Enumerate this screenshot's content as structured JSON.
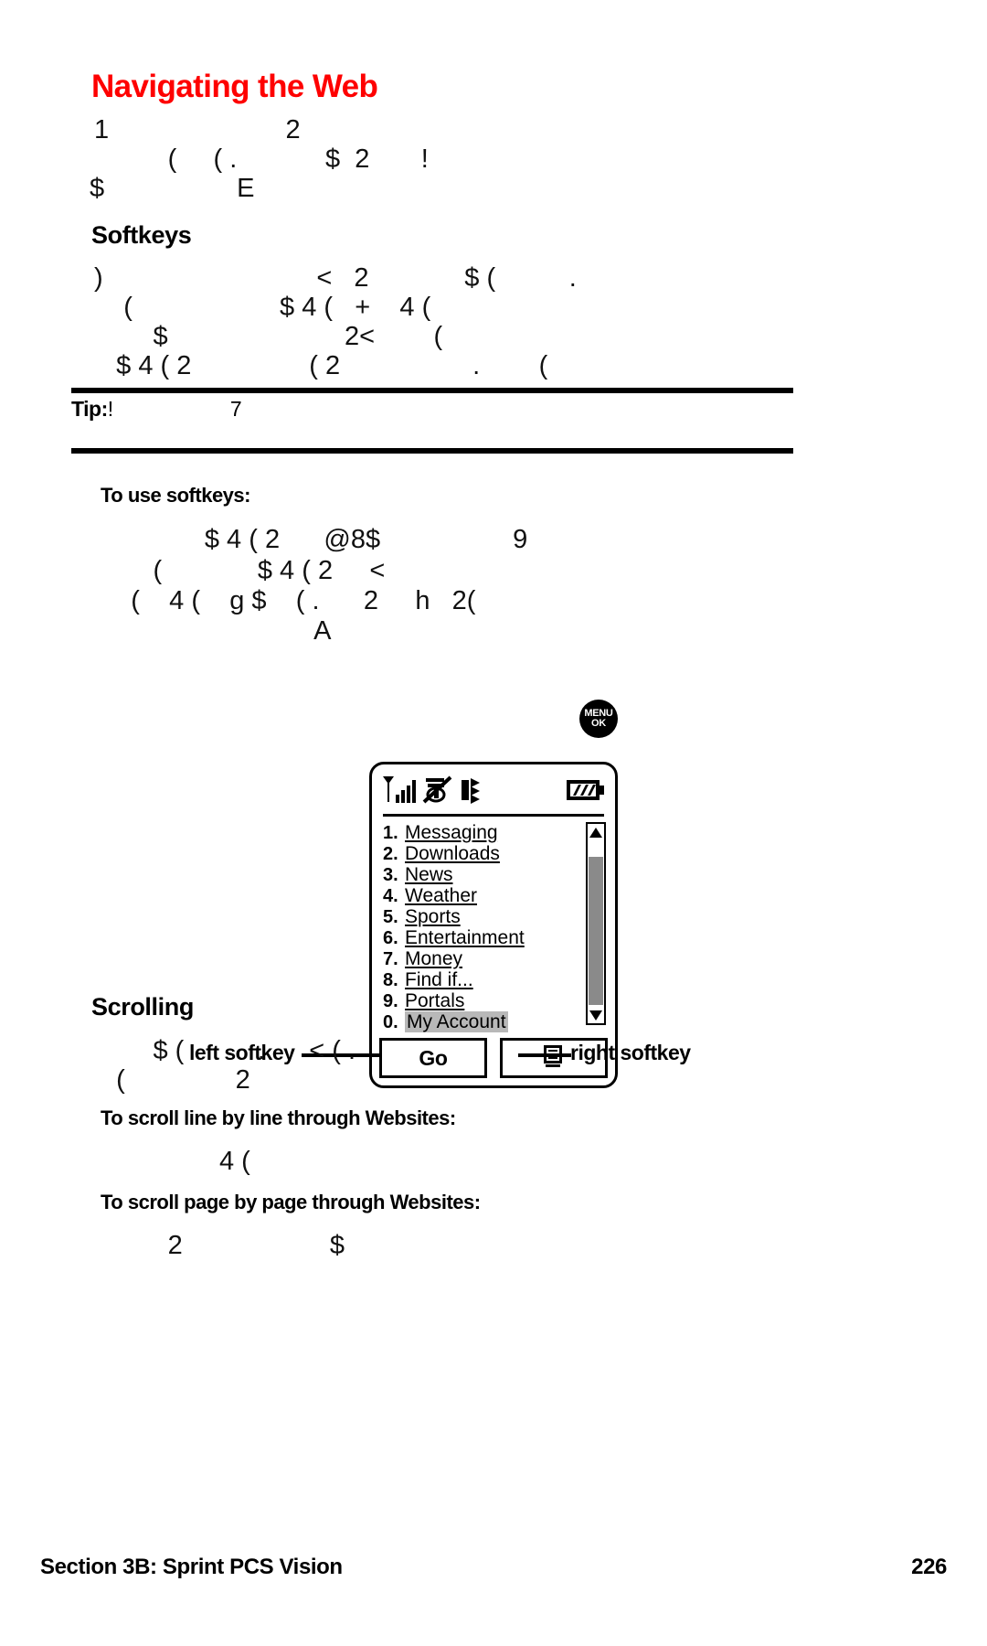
{
  "document": {
    "title": "Navigating the Web",
    "title_color": "#fe0000",
    "footer_left": "Section 3B: Sprint PCS Vision",
    "footer_right": "226"
  },
  "intro": {
    "line1": "1                        2",
    "line2": "          (     ( .            $  2       !",
    "line3": "$                  E"
  },
  "softkeys_section": {
    "heading": "Softkeys",
    "line1": ")                             <   2             $ (          .",
    "line2": "    (                    $ 4 (   +    4 (",
    "line3": "        $                        2<        (",
    "line4": "   $ 4 ( 2                ( 2                  .        ("
  },
  "tip": {
    "label": "Tip:",
    "text": "!                    7"
  },
  "use_softkeys": {
    "heading": "To use softkeys:",
    "line1": "               $ 4 ( 2      @8$                  9",
    "line2": "        (             $ 4 ( 2     <",
    "line3": "     (    4 (    g $    ( .      2     h   2(",
    "line4": "                              A",
    "key_icon": {
      "name": "menu-ok-key",
      "line1": "MENU",
      "line2": "OK"
    }
  },
  "phone": {
    "status_icons": [
      "signal-bars-icon",
      "no-service-icon",
      "vibrate-icon",
      "battery-icon"
    ],
    "menu_items": [
      {
        "num": "1.",
        "label": "Messaging",
        "selected": false
      },
      {
        "num": "2.",
        "label": "Downloads",
        "selected": false
      },
      {
        "num": "3.",
        "label": "News",
        "selected": false
      },
      {
        "num": "4.",
        "label": "Weather",
        "selected": false
      },
      {
        "num": "5.",
        "label": "Sports",
        "selected": false
      },
      {
        "num": "6.",
        "label": "Entertainment",
        "selected": false
      },
      {
        "num": "7.",
        "label": "Money",
        "selected": false
      },
      {
        "num": "8.",
        "label": "Find if...",
        "selected": false
      },
      {
        "num": "9.",
        "label": "Portals",
        "selected": false
      },
      {
        "num": "0.",
        "label": "My Account",
        "selected": true
      }
    ],
    "scrollbar": {
      "up_arrow": "scroll-up-arrow-icon",
      "down_arrow": "scroll-down-arrow-icon"
    },
    "softkey_left_label": "Go",
    "softkey_right_icon": "menu-list-icon"
  },
  "callouts": {
    "left": "left softkey",
    "right": "right softkey"
  },
  "scrolling_section": {
    "heading": "Scrolling",
    "line1": "        $ (          .      < ( .",
    "line2": "   (               2",
    "proc1_heading": "To scroll line by line through Websites:",
    "proc1_body": "                 4 (",
    "proc2_heading": "To scroll page by page through Websites:",
    "proc2_body": "          2                    $"
  }
}
